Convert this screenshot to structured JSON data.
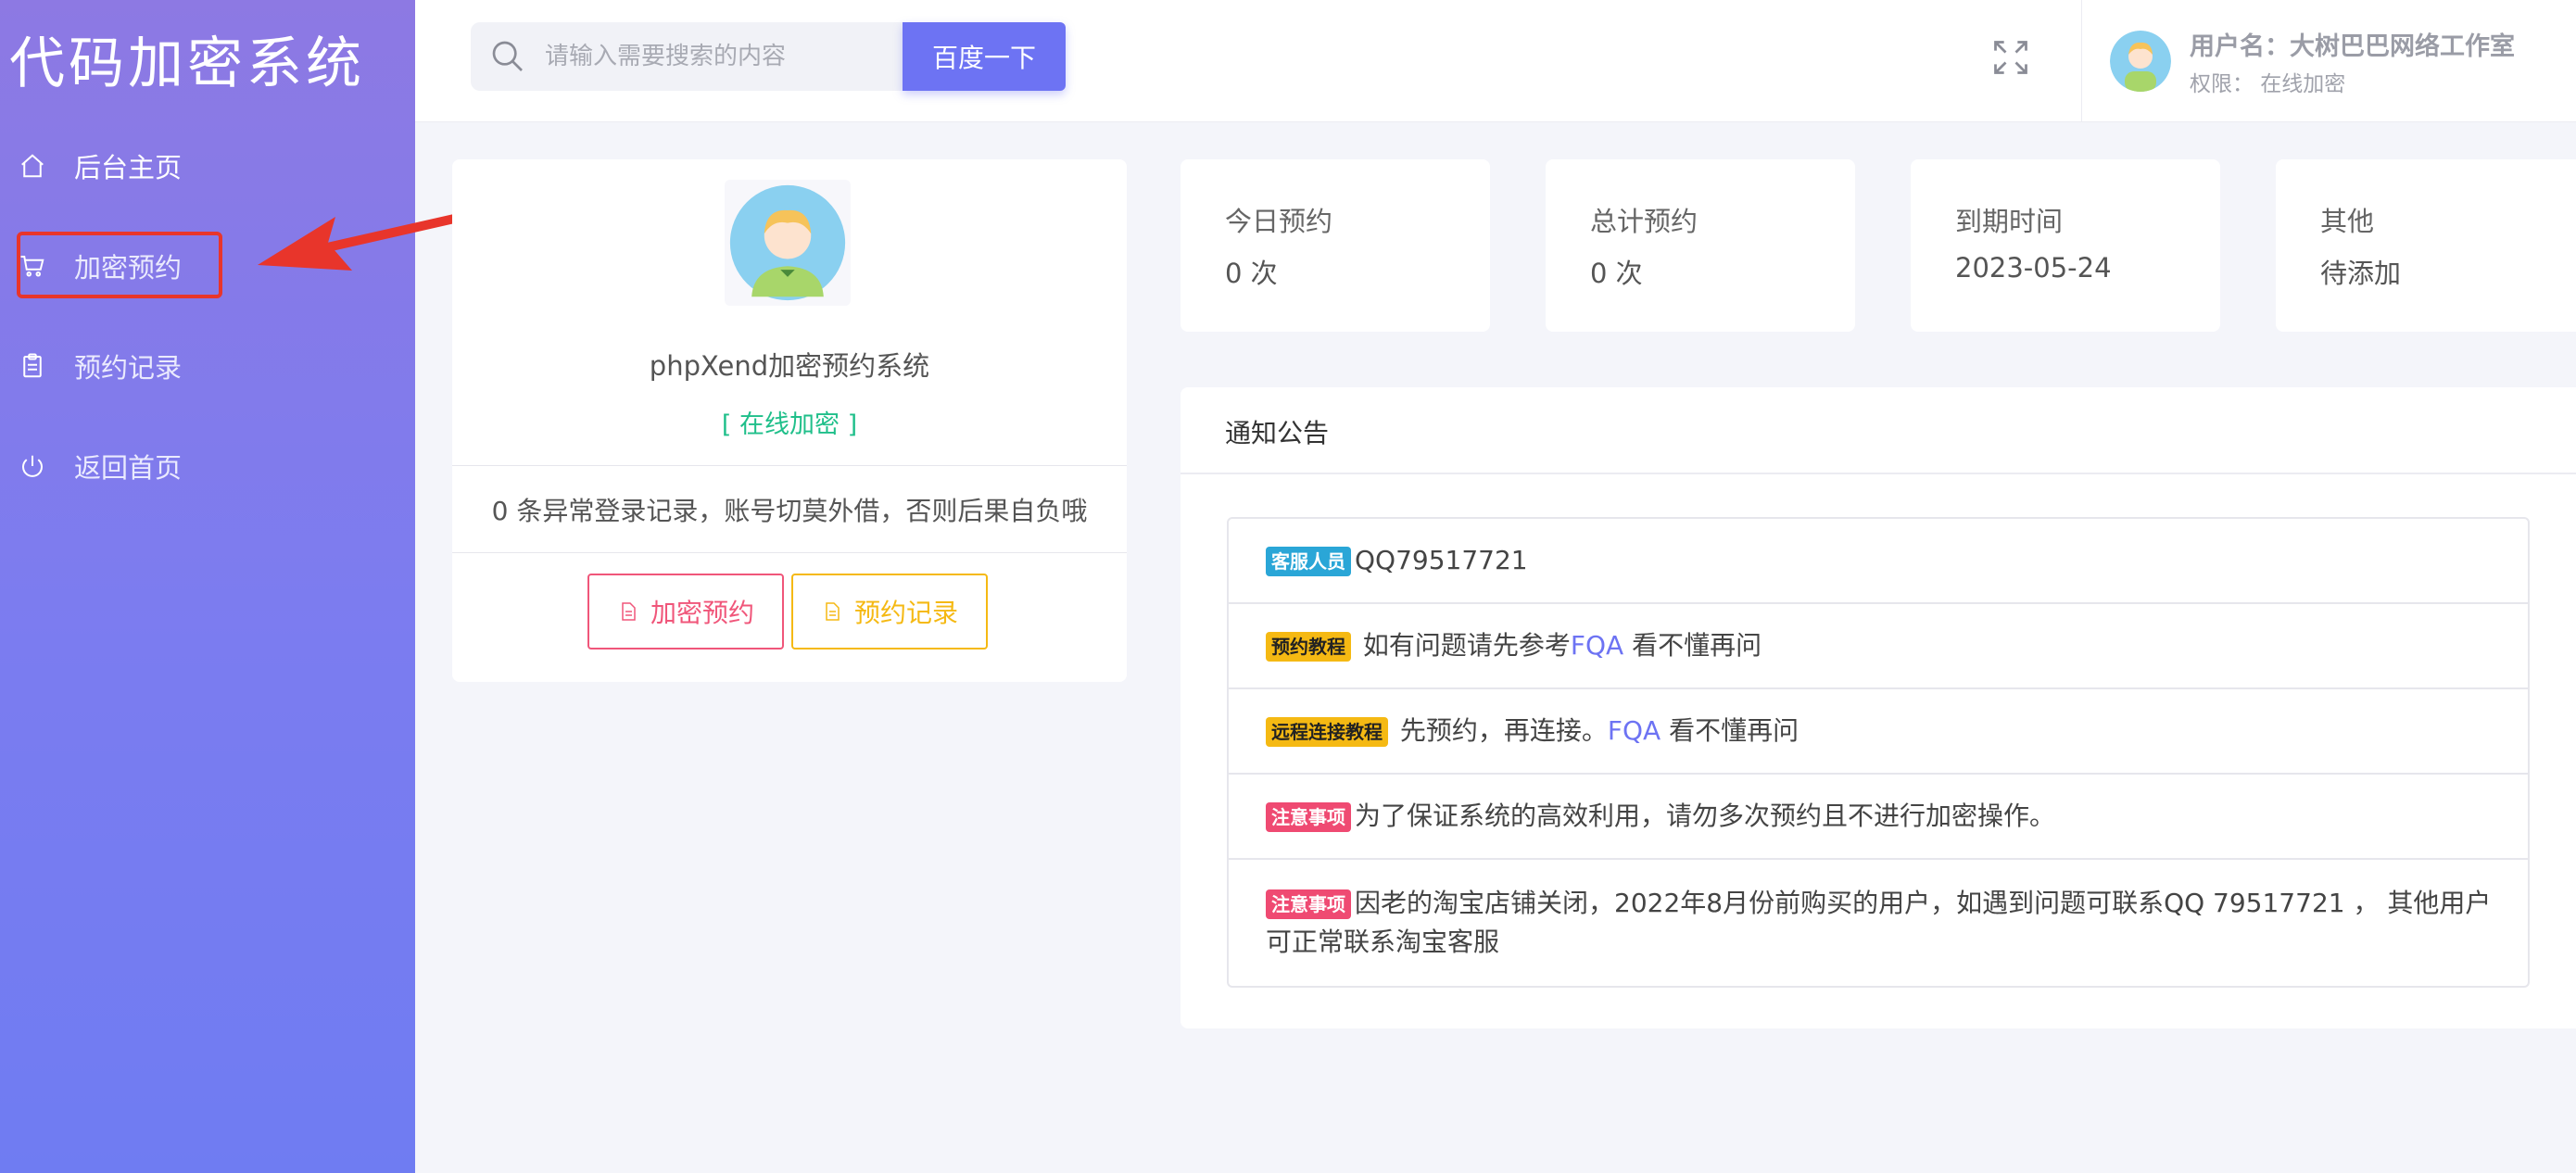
{
  "app": {
    "brand": "代码加密系统"
  },
  "sidebar": {
    "items": [
      {
        "label": "后台主页",
        "icon": "home-icon"
      },
      {
        "label": "加密预约",
        "icon": "cart-icon"
      },
      {
        "label": "预约记录",
        "icon": "clipboard-icon"
      },
      {
        "label": "返回首页",
        "icon": "power-icon"
      }
    ]
  },
  "header": {
    "search_placeholder": "请输入需要搜索的内容",
    "search_value": "",
    "search_button": "百度一下",
    "user": {
      "name": "用户名：大树巴巴网络工作室",
      "role": "权限： 在线加密"
    }
  },
  "profile": {
    "name": "phpXend加密预约系统",
    "role": "[ 在线加密 ]",
    "warning": "0 条异常登录记录，账号切莫外借，否则后果自负哦",
    "buttons": {
      "encrypt": "加密预约",
      "records": "预约记录"
    }
  },
  "stats": [
    {
      "label": "今日预约",
      "value": "0 次"
    },
    {
      "label": "总计预约",
      "value": "0 次"
    },
    {
      "label": "到期时间",
      "value": "2023-05-24"
    },
    {
      "label": "其他",
      "value": "待添加"
    }
  ],
  "notice": {
    "title": "通知公告",
    "items": [
      {
        "badge": "客服人员",
        "text": "QQ79517721"
      },
      {
        "badge": "预约教程",
        "text_before": " 如有问题请先参考",
        "link": "FQA",
        "text_after": " 看不懂再问"
      },
      {
        "badge": "远程连接教程",
        "text_before": " 先预约，再连接。",
        "link": "FQA",
        "text_after": " 看不懂再问"
      },
      {
        "badge": "注意事项",
        "text": "为了保证系统的高效利用，请勿多次预约且不进行加密操作。"
      },
      {
        "badge": "注意事项",
        "text": "因老的淘宝店铺关闭，2022年8月份前购买的用户，如遇到问题可联系QQ 79517721 ， 其他用户可正常联系淘宝客服"
      }
    ]
  },
  "colors": {
    "accent": "#6d73f3",
    "success": "#1fbf8a",
    "danger": "#f0567a",
    "warning": "#f5b913",
    "info": "#2aa6d7",
    "highlight": "#e8352b"
  }
}
